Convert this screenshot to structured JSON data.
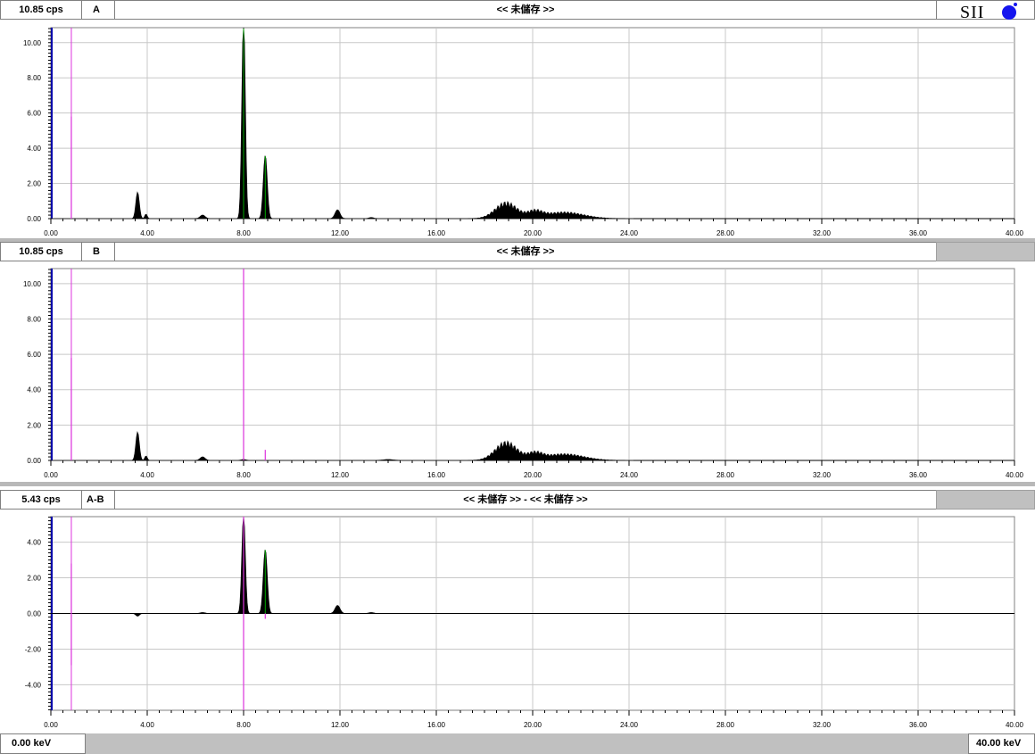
{
  "panels": [
    {
      "scale_label": "10.85 cps",
      "name": "A",
      "title": "<< 未儲存 >>"
    },
    {
      "scale_label": "10.85 cps",
      "name": "B",
      "title": "<< 未儲存 >>"
    },
    {
      "scale_label": "5.43 cps",
      "name": "A-B",
      "title": "<< 未儲存 >> - << 未儲存 >>"
    }
  ],
  "logo_text": "SII",
  "footer": {
    "left": "0.00 keV",
    "right": "40.00 keV"
  },
  "colors": {
    "spectrum": "#000000",
    "marker": "#dd33dd",
    "peak_highlight": "#00aa00",
    "grid": "#c8c8c8",
    "axis_blue": "#0000aa"
  },
  "chart_data": [
    {
      "type": "area",
      "title": "<< 未儲存 >>",
      "xlim": [
        0,
        40
      ],
      "ylim": [
        0,
        10.85
      ],
      "x_ticks": [
        "0.00",
        "4.00",
        "8.00",
        "12.00",
        "16.00",
        "20.00",
        "24.00",
        "28.00",
        "32.00",
        "36.00",
        "40.00"
      ],
      "y_ticks": [
        "0.00",
        "2.00",
        "4.00",
        "6.00",
        "8.00",
        "10.00"
      ],
      "grid": true,
      "markers": [
        {
          "x": 0.85,
          "y": 5.8
        }
      ],
      "peaks": [
        [
          3.6,
          1.5,
          0.07
        ],
        [
          3.95,
          0.25,
          0.05
        ],
        [
          6.3,
          0.2,
          0.1
        ],
        [
          8.0,
          11.5,
          0.07
        ],
        [
          8.9,
          3.6,
          0.08
        ],
        [
          11.9,
          0.5,
          0.1
        ],
        [
          13.3,
          0.06,
          0.1
        ],
        [
          18.9,
          0.75,
          0.45
        ],
        [
          20.1,
          0.3,
          0.3
        ],
        [
          21.3,
          0.3,
          0.8
        ]
      ]
    },
    {
      "type": "area",
      "title": "<< 未儲存 >>",
      "xlim": [
        0,
        40
      ],
      "ylim": [
        0,
        10.85
      ],
      "x_ticks": [
        "0.00",
        "4.00",
        "8.00",
        "12.00",
        "16.00",
        "20.00",
        "24.00",
        "28.00",
        "32.00",
        "36.00",
        "40.00"
      ],
      "y_ticks": [
        "0.00",
        "2.00",
        "4.00",
        "6.00",
        "8.00",
        "10.00"
      ],
      "grid": true,
      "markers": [
        {
          "x": 0.85,
          "y": 5.8
        },
        {
          "x": 8.0,
          "y": 10.85
        },
        {
          "x": 8.9,
          "y": 0.6
        }
      ],
      "peaks": [
        [
          3.6,
          1.6,
          0.07
        ],
        [
          3.95,
          0.25,
          0.05
        ],
        [
          6.3,
          0.2,
          0.1
        ],
        [
          8.0,
          0.05,
          0.1
        ],
        [
          14.0,
          0.05,
          0.2
        ],
        [
          18.9,
          0.85,
          0.45
        ],
        [
          20.1,
          0.3,
          0.3
        ],
        [
          21.3,
          0.3,
          0.8
        ]
      ]
    },
    {
      "type": "area",
      "title": "<< 未儲存 >> - << 未儲存 >>",
      "xlim": [
        0,
        40
      ],
      "ylim": [
        -5.43,
        5.43
      ],
      "x_ticks": [
        "0.00",
        "4.00",
        "8.00",
        "12.00",
        "16.00",
        "20.00",
        "24.00",
        "28.00",
        "32.00",
        "36.00",
        "40.00"
      ],
      "y_ticks": [
        "-4.00",
        "-2.00",
        "0.00",
        "2.00",
        "4.00"
      ],
      "grid": true,
      "markers": [
        {
          "x": 0.85,
          "y": 2.8
        },
        {
          "x": 0.85,
          "y": -2.9
        },
        {
          "x": 8.0,
          "y": 5.43
        },
        {
          "x": 8.0,
          "y": -5.43
        },
        {
          "x": 8.9,
          "y": -0.3
        }
      ],
      "peaks": [
        [
          3.6,
          -0.15,
          0.07
        ],
        [
          6.3,
          0.05,
          0.1
        ],
        [
          8.0,
          5.6,
          0.07
        ],
        [
          8.9,
          3.6,
          0.08
        ],
        [
          11.9,
          0.45,
          0.1
        ],
        [
          13.3,
          0.05,
          0.1
        ]
      ]
    }
  ]
}
